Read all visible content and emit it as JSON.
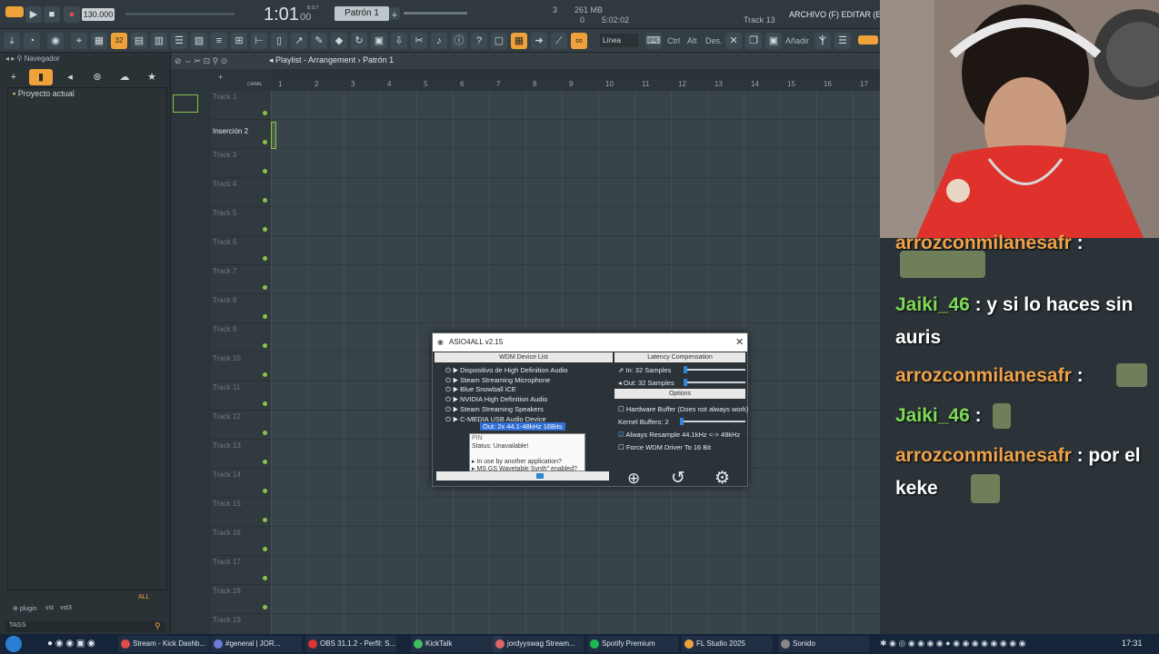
{
  "fl": {
    "tempo": "130.000",
    "time": "1:01",
    "time_sub": "00",
    "time_mode": "B:S:T",
    "pattern": "Patrón 1",
    "cpu_bars": "3",
    "memory": "261 MB",
    "memory_sub": "0",
    "elapsed": "5:02:02",
    "track_hint": "Track 13",
    "menu": "ARCHIVO (F)  EDITAR (E)  AÑADIR",
    "snap": "Línea",
    "mode_labels": [
      "Ctrl",
      "Alt",
      "Des.",
      "Añadir"
    ],
    "rec_badge": "32"
  },
  "browser": {
    "title": "Navegador",
    "project_label": "Proyecto actual",
    "footer_tags": [
      "plugin",
      "vst",
      "vst3"
    ],
    "tags_label": "TAGS",
    "all_label": "ALL"
  },
  "playlist": {
    "breadcrumb": "Playlist - Arrangement",
    "pattern": "Patrón 1",
    "channel_label": "CANAL",
    "ruler": [
      "1",
      "2",
      "3",
      "4",
      "5",
      "6",
      "7",
      "8",
      "9",
      "10",
      "11",
      "12",
      "13",
      "14",
      "15",
      "16",
      "17"
    ],
    "tracks": [
      "Track 1",
      "Inserción 2",
      "Track 3",
      "Track 4",
      "Track 5",
      "Track 6",
      "Track 7",
      "Track 8",
      "Track 9",
      "Track 10",
      "Track 11",
      "Track 12",
      "Track 13",
      "Track 14",
      "Track 15",
      "Track 16",
      "Track 17",
      "Track 18",
      "Track 19"
    ]
  },
  "chat": {
    "messages": [
      {
        "user": "arrozconmilanesafr",
        "text": ":",
        "user_color": "orange"
      },
      {
        "user": "Jaiki_46",
        "text": ": y si lo haces sin auris",
        "user_color": "green"
      },
      {
        "user": "arrozconmilanesafr",
        "text": ":",
        "user_color": "orange"
      },
      {
        "user": "Jaiki_46",
        "text": ":",
        "user_color": "green"
      },
      {
        "user": "arrozconmilanesafr",
        "text": ": por el keke",
        "user_color": "orange"
      }
    ]
  },
  "asio": {
    "title": "ASIO4ALL v2.15",
    "device_list_header": "WDM Device List",
    "latency_header": "Latency Compensation",
    "options_header": "Options",
    "devices": [
      "Dispositivo de High Definition Audio",
      "Steam Streaming Microphone",
      "Blue Snowball iCE",
      "NVIDIA High Definition Audio",
      "Steam Streaming Speakers",
      "C-MEDIA USB Audio Device"
    ],
    "selected_output": "Out: 2x 44.1-48kHz 16Bits",
    "tooltip_pin": "PIN",
    "tooltip_status": "Status:   Unavailable!",
    "tooltip_reasons": [
      "In use by another application?",
      "MS GS Wavetable Synth\" enabled?"
    ],
    "latency_in": "In: 32 Samples",
    "latency_out": "Out: 32 Samples",
    "hw_buffer": "Hardware Buffer (Does not always work)",
    "kernel_buffers": "Kernel Buffers: 2",
    "resample": "Always Resample 44.1kHz <-> 48kHz",
    "force_wdm": "Force WDM Driver To 16 Bit"
  },
  "taskbar": {
    "items": [
      "Stream - Kick Dashb...",
      "#general | JOR...",
      "OBS 31.1.2 - Perfil: S...",
      "KickTalk",
      "jordyyswag Stream...",
      "Spotify Premium",
      "FL Studio 2025",
      "Sonido"
    ],
    "clock": "17:31"
  }
}
